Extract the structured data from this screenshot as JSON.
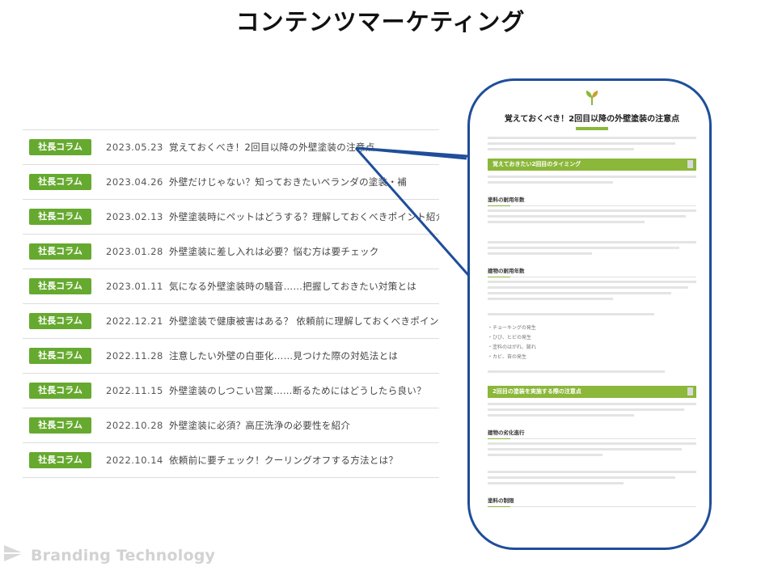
{
  "title": "コンテンツマーケティング",
  "list": {
    "items": [
      {
        "badge": "社長コラム",
        "date": "2023.05.23",
        "title": "覚えておくべき！2回目以降の外壁塗装の注意点"
      },
      {
        "badge": "社長コラム",
        "date": "2023.04.26",
        "title": "外壁だけじゃない？知っておきたいベランダの塗装・補"
      },
      {
        "badge": "社長コラム",
        "date": "2023.02.13",
        "title": "外壁塗装時にペットはどうする？理解しておくべきポイント紹介"
      },
      {
        "badge": "社長コラム",
        "date": "2023.01.28",
        "title": "外壁塗装に差し入れは必要？悩む方は要チェック"
      },
      {
        "badge": "社長コラム",
        "date": "2023.01.11",
        "title": "気になる外壁塗装時の騒音……把握しておきたい対策とは"
      },
      {
        "badge": "社長コラム",
        "date": "2022.12.21",
        "title": "外壁塗装で健康被害はある？ 依頼前に理解しておくべきポイント"
      },
      {
        "badge": "社長コラム",
        "date": "2022.11.28",
        "title": "注意したい外壁の白亜化……見つけた際の対処法とは"
      },
      {
        "badge": "社長コラム",
        "date": "2022.11.15",
        "title": "外壁塗装のしつこい営業……断るためにはどうしたら良い？"
      },
      {
        "badge": "社長コラム",
        "date": "2022.10.28",
        "title": "外壁塗装に必須？高圧洗浄の必要性を紹介"
      },
      {
        "badge": "社長コラム",
        "date": "2022.10.14",
        "title": "依頼前に要チェック！クーリングオフする方法とは？"
      }
    ]
  },
  "article": {
    "title": "覚えておくべき！2回目以降の外壁塗装の注意点",
    "section1": "覚えておきたい2回目のタイミング",
    "sub1": "塗料の耐用年数",
    "sub2": "建物の耐用年数",
    "bullets": [
      "・チョーキングの発生",
      "・ひび、ヒビの発生",
      "・塗料のはがれ、膨れ",
      "・カビ、苔の発生"
    ],
    "section2": "2回目の塗装を実施する際の注意点",
    "sub3": "建物の劣化進行",
    "sub4": "塗料の制限"
  },
  "brand": "Branding Technology",
  "colors": {
    "badge": "#66a92f",
    "bubble_border": "#1f4e9a",
    "article_accent": "#8bb73a"
  }
}
